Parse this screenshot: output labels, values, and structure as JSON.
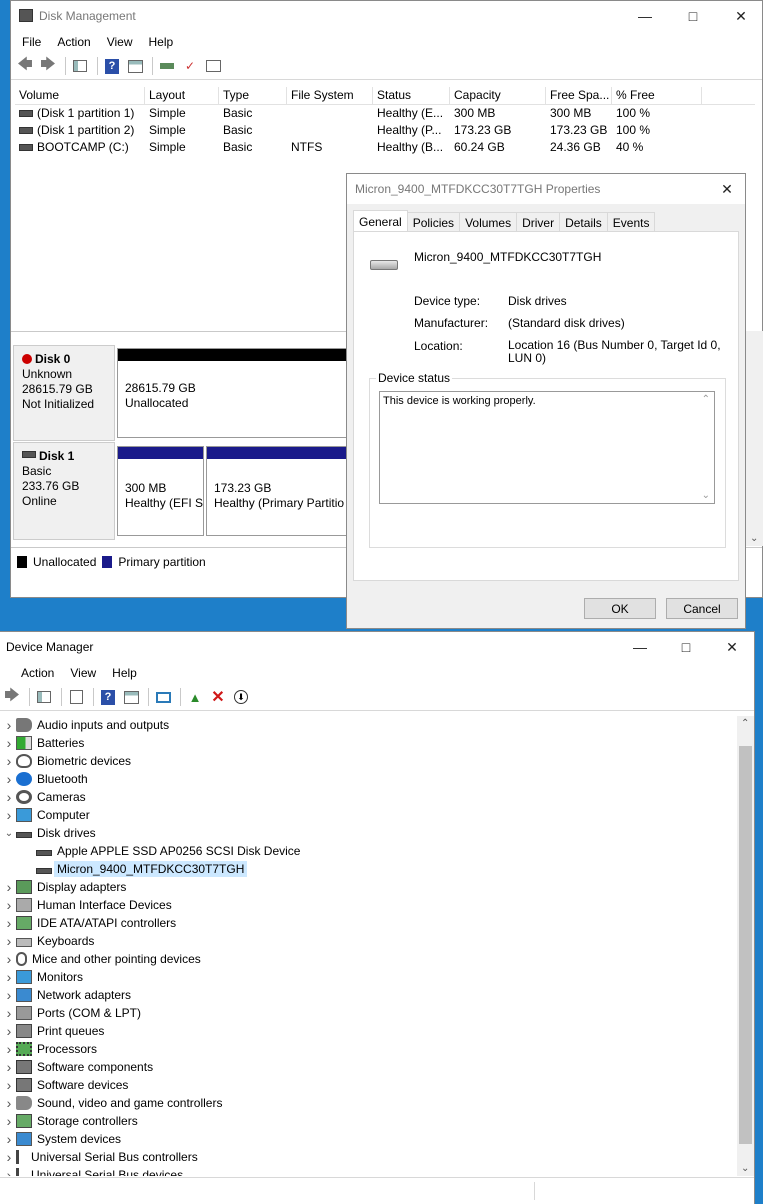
{
  "disk_mgmt": {
    "title": "Disk Management",
    "menu": [
      "File",
      "Action",
      "View",
      "Help"
    ],
    "columns": [
      "Volume",
      "Layout",
      "Type",
      "File System",
      "Status",
      "Capacity",
      "Free Spa...",
      "% Free"
    ],
    "rows": [
      [
        "(Disk 1 partition 1)",
        "Simple",
        "Basic",
        "",
        "Healthy (E...",
        "300 MB",
        "300 MB",
        "100 %"
      ],
      [
        "(Disk 1 partition 2)",
        "Simple",
        "Basic",
        "",
        "Healthy (P...",
        "173.23 GB",
        "173.23 GB",
        "100 %"
      ],
      [
        "BOOTCAMP (C:)",
        "Simple",
        "Basic",
        "NTFS",
        "Healthy (B...",
        "60.24 GB",
        "24.36 GB",
        "40 %"
      ]
    ],
    "disk0": {
      "name": "Disk 0",
      "type": "Unknown",
      "size": "28615.79 GB",
      "state": "Not Initialized",
      "part_size": "28615.79 GB",
      "part_label": "Unallocated"
    },
    "disk1": {
      "name": "Disk 1",
      "type": "Basic",
      "size": "233.76 GB",
      "state": "Online",
      "p1_size": "300 MB",
      "p1_label": "Healthy (EFI S",
      "p2_size": "173.23 GB",
      "p2_label": "Healthy (Primary Partitio"
    },
    "legend": {
      "unallocated": "Unallocated",
      "primary": "Primary partition"
    }
  },
  "props": {
    "title": "Micron_9400_MTFDKCC30T7TGH Properties",
    "tabs": [
      "General",
      "Policies",
      "Volumes",
      "Driver",
      "Details",
      "Events"
    ],
    "device_name": "Micron_9400_MTFDKCC30T7TGH",
    "device_type_label": "Device type:",
    "device_type": "Disk drives",
    "manufacturer_label": "Manufacturer:",
    "manufacturer": "(Standard disk drives)",
    "location_label": "Location:",
    "location": "Location 16 (Bus Number 0, Target Id 0, LUN 0)",
    "status_group": "Device status",
    "status_text": "This device is working properly.",
    "ok": "OK",
    "cancel": "Cancel"
  },
  "devmgr": {
    "title": "Device Manager",
    "menu": [
      "Action",
      "View",
      "Help"
    ],
    "tree": [
      {
        "label": "Audio inputs and outputs",
        "icon": "speaker-icon"
      },
      {
        "label": "Batteries",
        "icon": "battery-icon"
      },
      {
        "label": "Biometric devices",
        "icon": "fingerprint-icon"
      },
      {
        "label": "Bluetooth",
        "icon": "bluetooth-icon"
      },
      {
        "label": "Cameras",
        "icon": "camera-icon"
      },
      {
        "label": "Computer",
        "icon": "computer-icon"
      },
      {
        "label": "Disk drives",
        "icon": "disk-drive-icon",
        "expanded": true
      },
      {
        "label": "Apple APPLE SSD AP0256 SCSI Disk Device",
        "icon": "disk-drive-icon",
        "child": true
      },
      {
        "label": "Micron_9400_MTFDKCC30T7TGH",
        "icon": "disk-drive-icon",
        "child": true,
        "selected": true
      },
      {
        "label": "Display adapters",
        "icon": "display-adapter-icon"
      },
      {
        "label": "Human Interface Devices",
        "icon": "hid-icon"
      },
      {
        "label": "IDE ATA/ATAPI controllers",
        "icon": "ide-controller-icon"
      },
      {
        "label": "Keyboards",
        "icon": "keyboard-icon"
      },
      {
        "label": "Mice and other pointing devices",
        "icon": "mouse-icon"
      },
      {
        "label": "Monitors",
        "icon": "monitor-icon"
      },
      {
        "label": "Network adapters",
        "icon": "network-icon"
      },
      {
        "label": "Ports (COM & LPT)",
        "icon": "port-icon"
      },
      {
        "label": "Print queues",
        "icon": "printer-icon"
      },
      {
        "label": "Processors",
        "icon": "processor-icon"
      },
      {
        "label": "Software components",
        "icon": "software-component-icon"
      },
      {
        "label": "Software devices",
        "icon": "software-device-icon"
      },
      {
        "label": "Sound, video and game controllers",
        "icon": "sound-icon"
      },
      {
        "label": "Storage controllers",
        "icon": "storage-controller-icon"
      },
      {
        "label": "System devices",
        "icon": "system-device-icon"
      },
      {
        "label": "Universal Serial Bus controllers",
        "icon": "usb-icon"
      },
      {
        "label": "Universal Serial Bus devices",
        "icon": "usb-icon"
      }
    ]
  }
}
